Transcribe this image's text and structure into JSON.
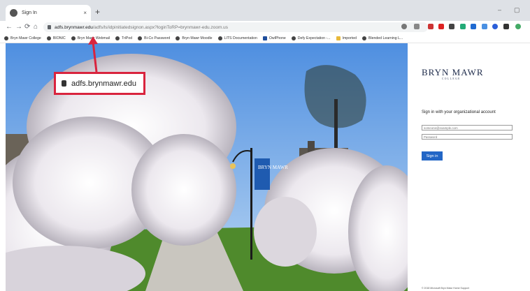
{
  "browser": {
    "tab_title": "Sign In",
    "tab_close": "×",
    "new_tab": "+",
    "minimize": "–",
    "maximize": "▢",
    "url_domain": "adfs.brynmawr.edu",
    "url_path": "/adfs/ls/idpinitiatedsignon.aspx?loginToRP=brynmawr-edu.zoom.us",
    "nav": {
      "back": "←",
      "forward": "→",
      "reload": "⟳",
      "home": "⌂"
    }
  },
  "bookmarks": [
    "Bryn Mawr College",
    "BIONIC",
    "Bryn Mawr Webmail",
    "TriPod",
    "Bi-Co Password",
    "Bryn Mawr Moodle",
    "LITS Documentation",
    "OwlPhone",
    "Defy Expectation -...",
    "Imported",
    "Blended Learning L..."
  ],
  "callout": {
    "text": "adfs.brynmawr.edu"
  },
  "banner": {
    "letters": "BRYN MAWR"
  },
  "panel": {
    "logo": "BRYN MAWR",
    "logo_sub": "COLLEGE",
    "signin_title": "Sign in with your organizational account",
    "email_placeholder": "someone@example.com",
    "password_placeholder": "Password",
    "signin_button": "Sign in",
    "footer": "© 2018 Microsoft   Bryn Mawr Home   Support"
  },
  "colors": {
    "accent": "#2266c6",
    "callout": "#d9243e",
    "logo": "#1d2a4a"
  }
}
